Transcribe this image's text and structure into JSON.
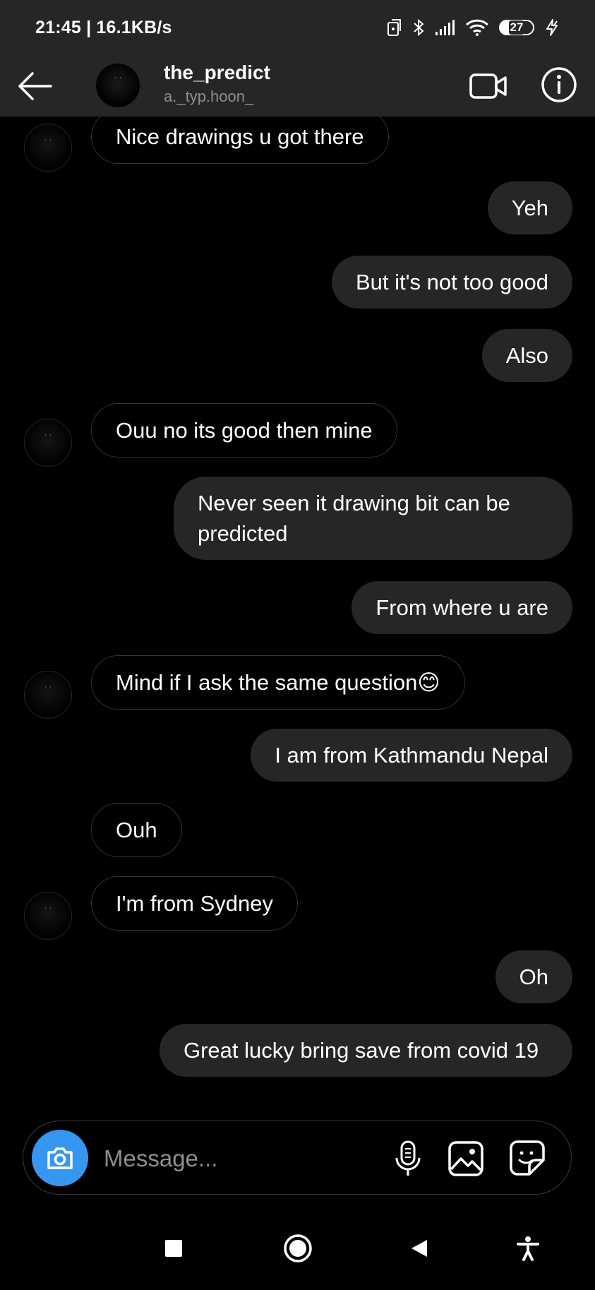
{
  "status_bar": {
    "time_speed": "21:45 | 16.1KB/s",
    "battery": "27"
  },
  "header": {
    "title": "the_predict",
    "subtitle": "a._typ.hoon_"
  },
  "messages": [
    {
      "side": "in",
      "text": "Nice drawings u got there"
    },
    {
      "side": "out",
      "text": "Yeh"
    },
    {
      "side": "out",
      "text": "But it's not too good"
    },
    {
      "side": "out",
      "text": "Also"
    },
    {
      "side": "in",
      "text": "Ouu no its good then mine"
    },
    {
      "side": "out",
      "text": "Never seen it drawing bit can be predicted"
    },
    {
      "side": "out",
      "text": "From where u are"
    },
    {
      "side": "in",
      "text": "Mind if I ask the same question😊"
    },
    {
      "side": "out",
      "text": "I am from Kathmandu Nepal"
    },
    {
      "side": "in",
      "text": "Ouh"
    },
    {
      "side": "in",
      "text": "I'm from Sydney"
    },
    {
      "side": "out",
      "text": "Oh"
    },
    {
      "side": "out",
      "text": "Great lucky bring save from covid 19"
    }
  ],
  "composer": {
    "placeholder": "Message..."
  },
  "icons": {
    "back": "arrow-left-icon",
    "video": "video-camera-icon",
    "info": "info-icon",
    "camera": "camera-icon",
    "mic": "microphone-icon",
    "gallery": "image-icon",
    "sticker": "sticker-icon"
  },
  "colors": {
    "background": "#000000",
    "bubble_out": "#262626",
    "header": "#262626",
    "accent": "#3797f0",
    "muted_text": "#8e8e8e"
  }
}
